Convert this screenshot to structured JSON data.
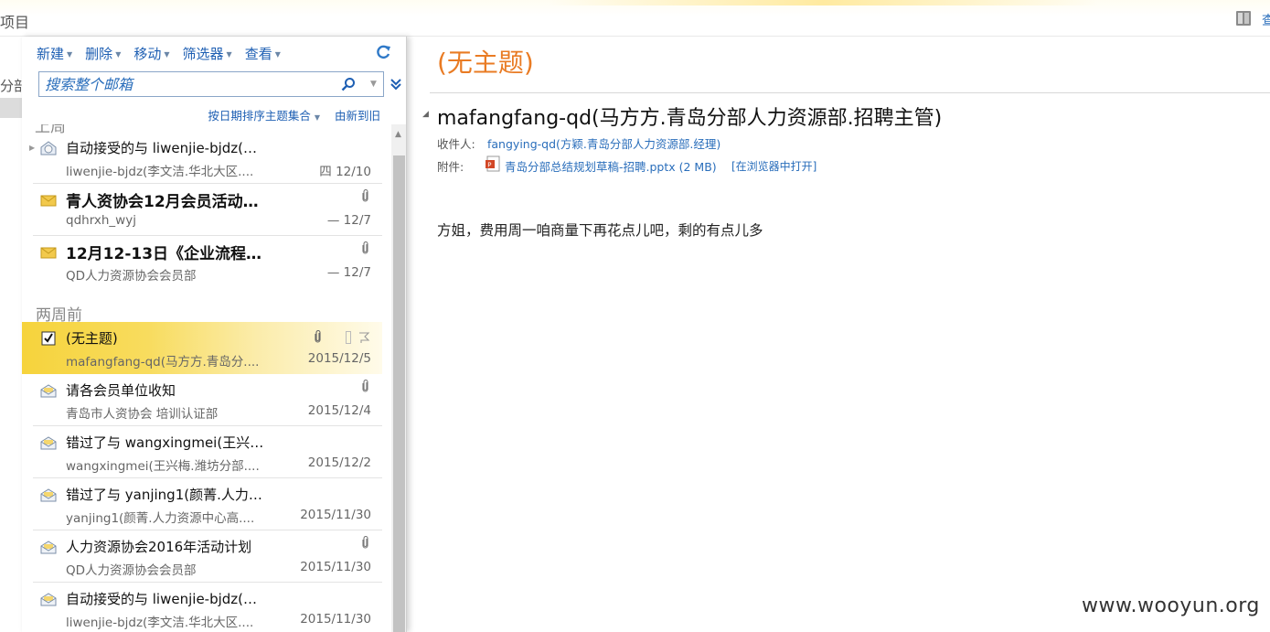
{
  "top": {
    "left_text": "项目",
    "right_cut": "查"
  },
  "sidebar": {
    "cut_text": "分部"
  },
  "toolbar": [
    {
      "label": "新建"
    },
    {
      "label": "删除"
    },
    {
      "label": "移动"
    },
    {
      "label": "筛选器"
    },
    {
      "label": "查看"
    }
  ],
  "search": {
    "placeholder": "搜索整个邮箱"
  },
  "sort": {
    "by": "按日期排序主题集合",
    "order": "由新到旧"
  },
  "groups": {
    "cut": "上周",
    "two_weeks": "两周前"
  },
  "mails": [
    {
      "subject": "自动接受的与 liwenjie-bjdz(…",
      "sender": "liwenjie-bjdz(李文洁.华北大区....",
      "date": "四 12/10",
      "icon": "meeting-accepted-icon",
      "bold": false,
      "attachment": false
    },
    {
      "subject": "青人资协会12月会员活动…",
      "sender": "qdhrxh_wyj",
      "date": "— 12/7",
      "icon": "envelope-unread-icon",
      "bold": true,
      "attachment": true
    },
    {
      "subject": "12月12-13日《企业流程…",
      "sender": "QD人力资源协会会员部",
      "date": "— 12/7",
      "icon": "envelope-unread-icon",
      "bold": true,
      "attachment": true
    },
    {
      "subject": "(无主题)",
      "sender": "mafangfang-qd(马方方.青岛分....",
      "date": "2015/12/5",
      "icon": "checkbox-checked-icon",
      "bold": false,
      "attachment": true,
      "selected": true
    },
    {
      "subject": "请各会员单位收知",
      "sender": "青岛市人资协会 培训认证部",
      "date": "2015/12/4",
      "icon": "envelope-read-icon",
      "bold": false,
      "attachment": true
    },
    {
      "subject": "错过了与 wangxingmei(王兴…",
      "sender": "wangxingmei(王兴梅.潍坊分部....",
      "date": "2015/12/2",
      "icon": "meeting-missed-icon",
      "bold": false,
      "attachment": false
    },
    {
      "subject": "错过了与 yanjing1(颜菁.人力…",
      "sender": "yanjing1(颜菁.人力资源中心高....",
      "date": "2015/11/30",
      "icon": "meeting-missed-icon",
      "bold": false,
      "attachment": false
    },
    {
      "subject": "人力资源协会2016年活动计划",
      "sender": "QD人力资源协会会员部",
      "date": "2015/11/30",
      "icon": "envelope-read-icon",
      "bold": false,
      "attachment": true
    },
    {
      "subject": "自动接受的与 liwenjie-bjdz(…",
      "sender": "liwenjie-bjdz(李文洁.华北大区....",
      "date": "2015/11/30",
      "icon": "meeting-accepted-icon",
      "bold": false,
      "attachment": false
    }
  ],
  "reading": {
    "subject": "(无主题)",
    "from": "mafangfang-qd(马方方.青岛分部人力资源部.招聘主管)",
    "to_label": "收件人:",
    "to": "fangying-qd(方颖.青岛分部人力资源部.经理)",
    "att_label": "附件:",
    "attachment": "青岛分部总结规划草稿-招聘.pptx (2 MB)",
    "open_in_browser": "[在浏览器中打开]",
    "body": "方姐，费用周一咱商量下再花点儿吧，剩的有点儿多"
  },
  "watermark": "www.wooyun.org",
  "colors": {
    "accent_orange": "#e97b23",
    "link_blue": "#2a6ebb",
    "selected_yellow": "#f6d33c"
  }
}
